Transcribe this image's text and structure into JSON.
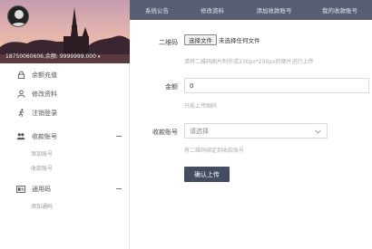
{
  "profile": {
    "user_info": "18750060606,余额: 9999999.000",
    "caret": "▾"
  },
  "sidebar": {
    "items": [
      {
        "label": "余额充值",
        "icon": "lock-icon"
      },
      {
        "label": "修改资料",
        "icon": "user-icon"
      },
      {
        "label": "注销登录",
        "icon": "run-icon"
      },
      {
        "label": "收款账号",
        "icon": "users-icon",
        "sub": [
          "添加账号",
          "收款账号"
        ]
      },
      {
        "label": "通用码",
        "icon": "card-icon",
        "sub": [
          "添加通码"
        ]
      }
    ]
  },
  "topbar": {
    "tabs": [
      "系统公告",
      "修改资料",
      "添加收款账号",
      "我的收款账号"
    ]
  },
  "form": {
    "qrcode_label": "二维码",
    "file_button": "选择文件",
    "file_status": "未选择任何文件",
    "qrcode_hint": "请将二维码图片制作成230px*230px的图片进行上传",
    "amount_label": "金额",
    "amount_value": "0",
    "amount_hint": "只能上传图码",
    "account_label": "收款账号",
    "account_placeholder": "请选择",
    "account_hint": "将二维码绑定到收款账号",
    "submit_label": "确认上传"
  },
  "colors": {
    "topbar": "#575d72",
    "submit": "#444c5f"
  }
}
